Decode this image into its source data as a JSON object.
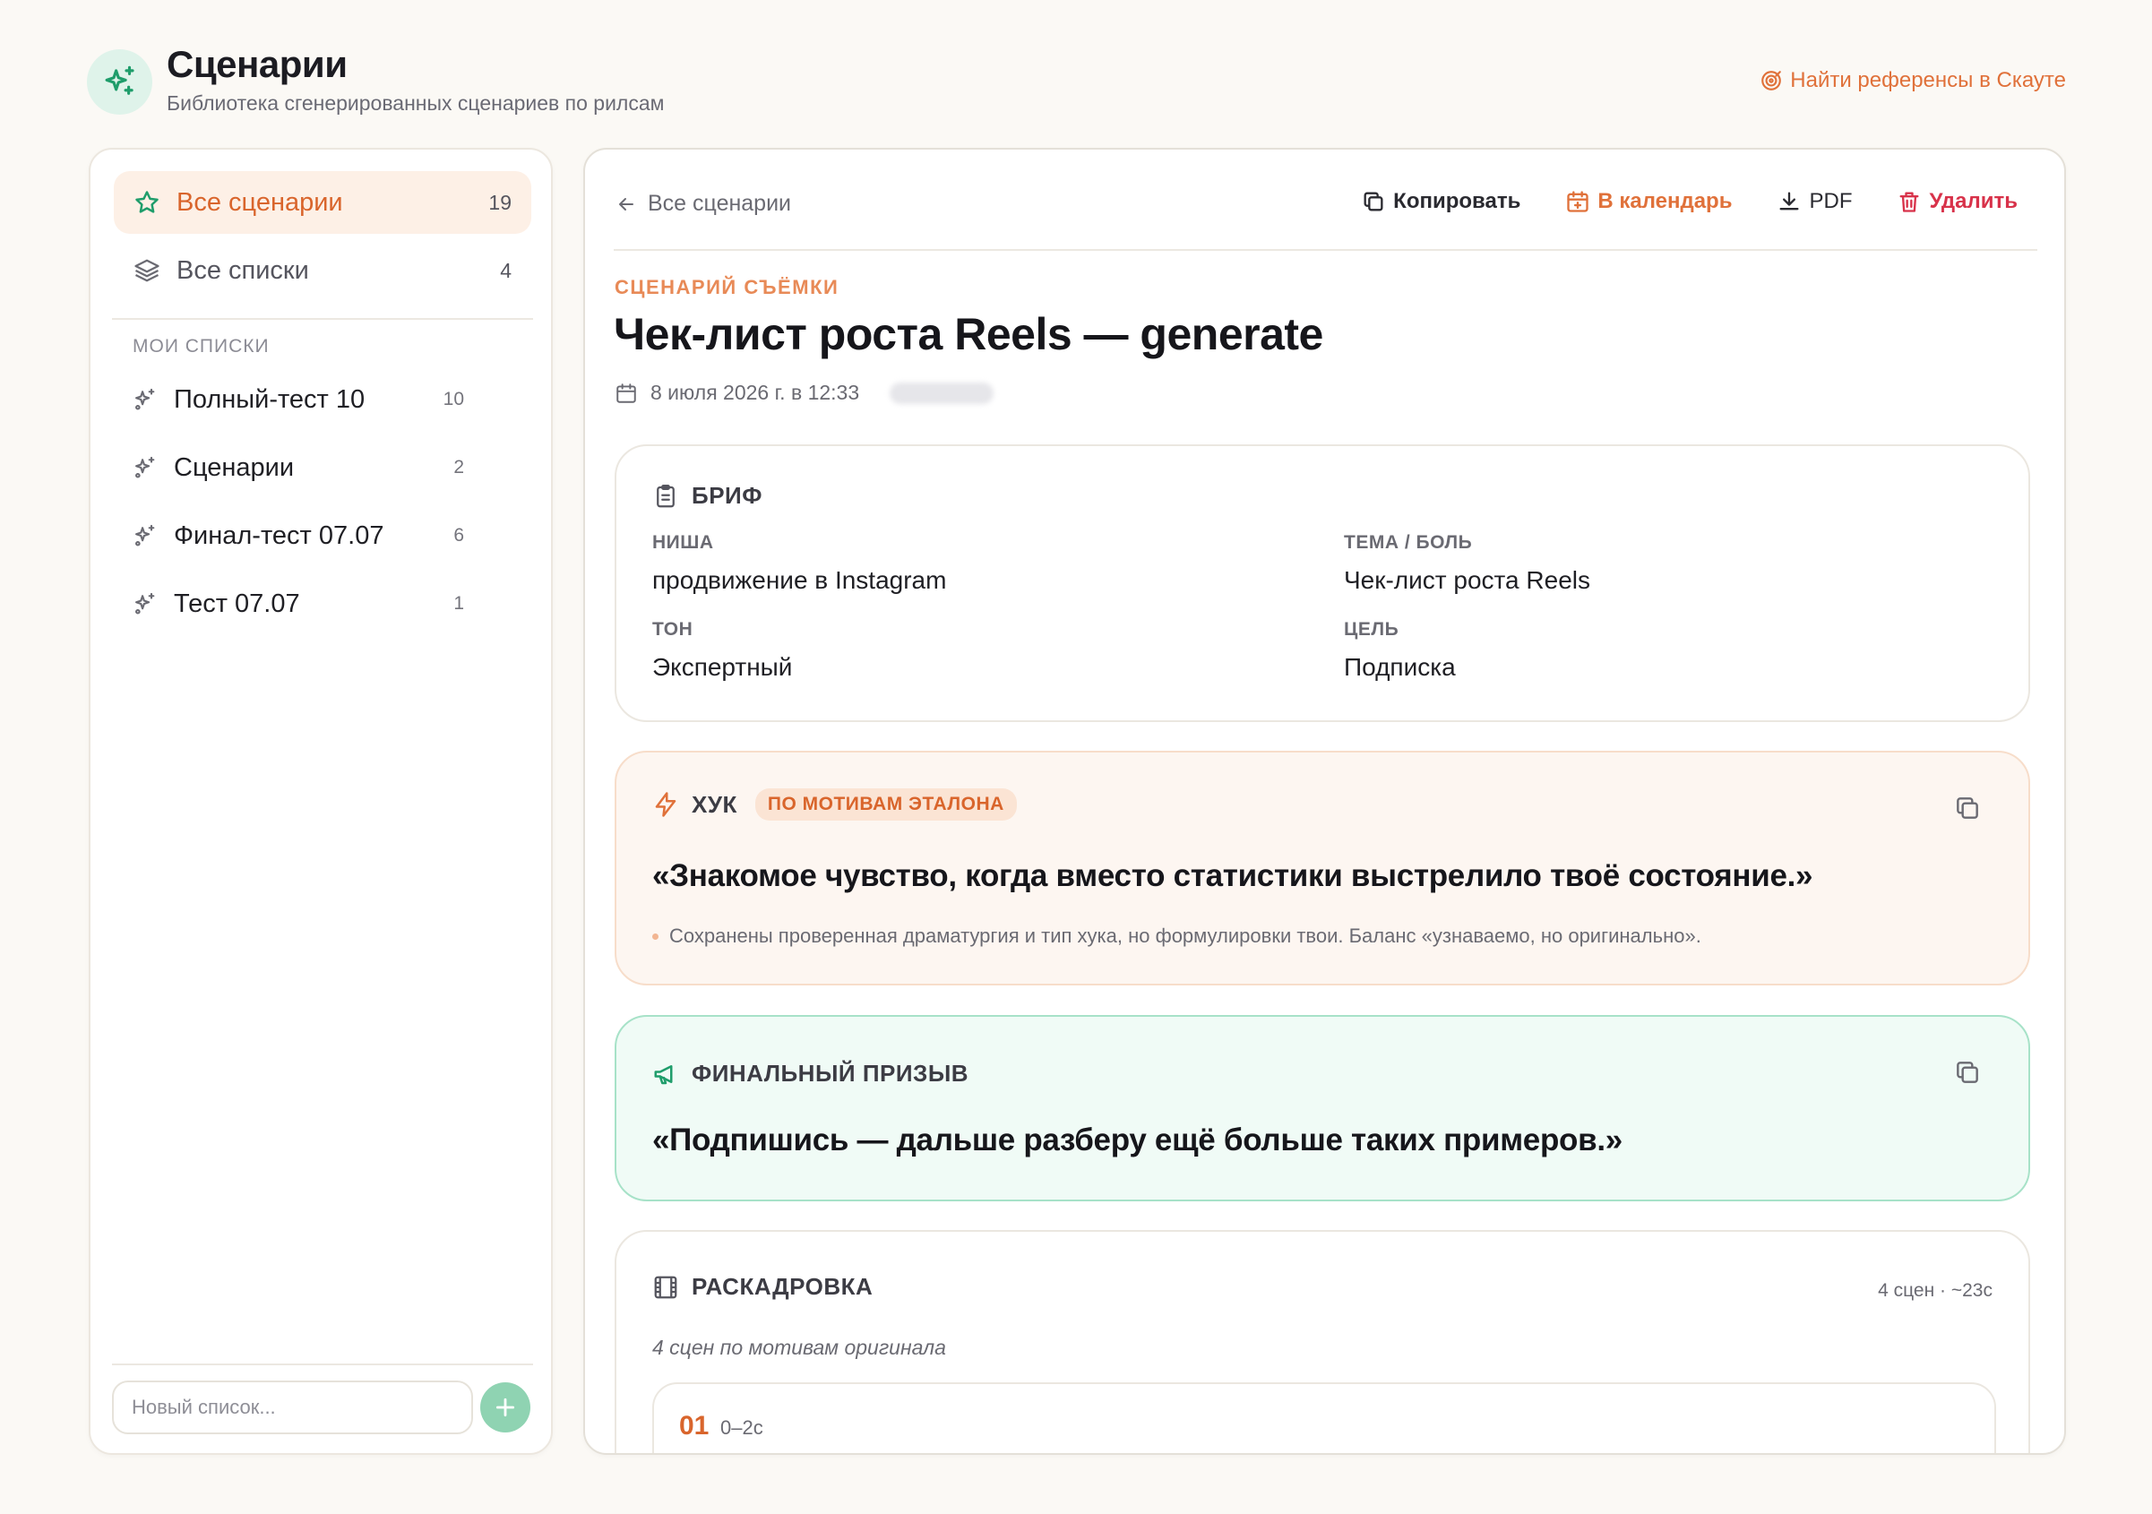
{
  "header": {
    "title": "Сценарии",
    "subtitle": "Библиотека сгенерированных сценариев по рилсам",
    "scout_link": "Найти референсы в Скауте"
  },
  "sidebar": {
    "all_scenarios": {
      "label": "Все сценарии",
      "count": "19"
    },
    "all_lists": {
      "label": "Все списки",
      "count": "4"
    },
    "section_title": "МОИ СПИСКИ",
    "lists": [
      {
        "label": "Полный-тест 10",
        "count": "10"
      },
      {
        "label": "Сценарии",
        "count": "2"
      },
      {
        "label": "Финал-тест 07.07",
        "count": "6"
      },
      {
        "label": "Тест 07.07",
        "count": "1"
      }
    ],
    "new_list_placeholder": "Новый список..."
  },
  "main": {
    "back_label": "Все сценарии",
    "toolbar": {
      "copy": "Копировать",
      "calendar": "В календарь",
      "pdf": "PDF",
      "delete": "Удалить"
    },
    "overline": "СЦЕНАРИЙ СЪЁМКИ",
    "title": "Чек-лист роста Reels — generate",
    "date": "8 июля 2026 г. в 12:33",
    "brief": {
      "heading": "БРИФ",
      "niche_label": "НИША",
      "niche_value": "продвижение в Instagram",
      "topic_label": "ТЕМА / БОЛЬ",
      "topic_value": "Чек-лист роста Reels",
      "tone_label": "ТОН",
      "tone_value": "Экспертный",
      "goal_label": "ЦЕЛЬ",
      "goal_value": "Подписка"
    },
    "hook": {
      "heading": "ХУК",
      "badge": "ПО МОТИВАМ ЭТАЛОНА",
      "quote": "«Знакомое чувство, когда вместо статистики выстрелило твоё состояние.»",
      "note": "Сохранены проверенная драматургия и тип хука, но формулировки твои. Баланс «узнаваемо, но оригинально»."
    },
    "cta": {
      "heading": "ФИНАЛЬНЫЙ ПРИЗЫВ",
      "quote": "«Подпишись — дальше разберу ещё больше таких примеров.»"
    },
    "storyboard": {
      "heading": "РАСКАДРОВКА",
      "meta": "4 сцен · ~23с",
      "subtitle": "4 сцен по мотивам оригинала",
      "first_scene_num": "01",
      "first_scene_time": "0–2с"
    }
  },
  "colors": {
    "accent_orange": "#e0713a",
    "accent_green": "#1f9d6b",
    "danger_red": "#d8324a",
    "background": "#fbf9f5"
  },
  "icons": {
    "logo": "sparkles-icon",
    "scout": "target-icon",
    "all_scenarios": "star-icon",
    "all_lists": "layers-icon",
    "list_item": "sparkles-icon",
    "add": "plus-icon",
    "back": "arrow-left-icon",
    "copy": "copy-icon",
    "calendar": "calendar-plus-icon",
    "pdf": "download-icon",
    "delete": "trash-icon",
    "date": "calendar-icon",
    "brief": "clipboard-icon",
    "hook": "zap-icon",
    "cta": "megaphone-icon",
    "storyboard": "film-icon"
  }
}
